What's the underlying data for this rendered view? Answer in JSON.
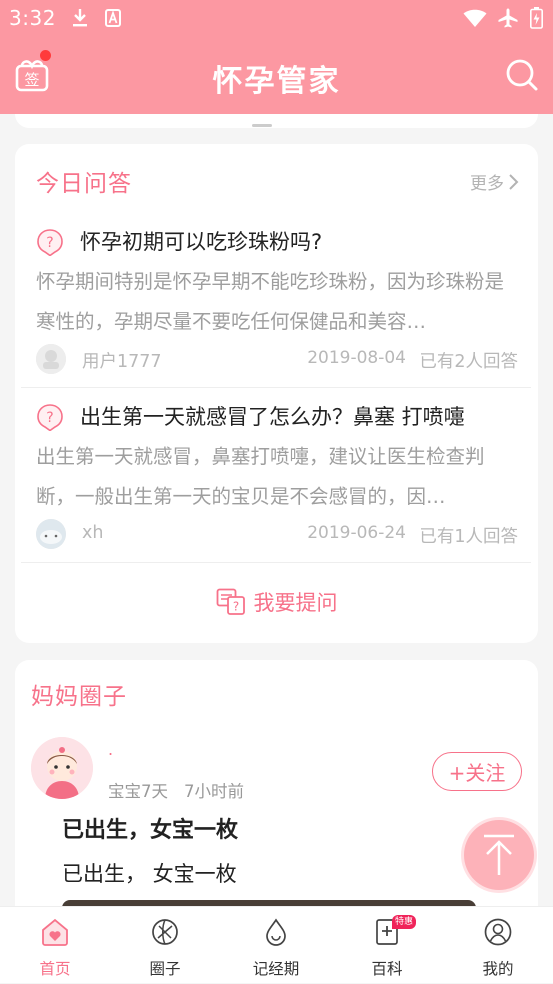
{
  "status_bar": {
    "time": "3:32",
    "icons": [
      "download-icon",
      "a-icon",
      "wifi-icon",
      "airplane-icon",
      "battery-icon"
    ]
  },
  "header": {
    "title": "怀孕管家",
    "checkin_label": "签",
    "left_icon": "checkin-gift-icon",
    "right_icon": "search-icon"
  },
  "qa": {
    "title": "今日问答",
    "more_label": "更多",
    "items": [
      {
        "question": "怀孕初期可以吃珍珠粉吗?",
        "answer_preview": "怀孕期间特别是怀孕早期不能吃珍珠粉，因为珍珠粉是寒性的，孕期尽量不要吃任何保健品和美容…",
        "user": "用户1777",
        "date": "2019-08-04",
        "answers": "已有2人回答"
      },
      {
        "question": "出生第一天就感冒了怎么办？鼻塞 打喷嚏",
        "answer_preview": "出生第一天就感冒，鼻塞打喷嚏，建议让医生检查判断，一般出生第一天的宝贝是不会感冒的，因…",
        "user": "xh",
        "date": "2019-06-24",
        "answers": "已有1人回答"
      }
    ],
    "ask_label": "我要提问"
  },
  "circle": {
    "title": "妈妈圈子",
    "post": {
      "author": ".",
      "baby_age": "宝宝7天",
      "time_ago": "7小时前",
      "follow_label": "+关注",
      "title": "已出生，女宝一枚",
      "body": "已出生， 女宝一枚"
    }
  },
  "tabbar": {
    "tabs": [
      {
        "label": "首页",
        "icon": "home-heart-icon",
        "active": true
      },
      {
        "label": "圈子",
        "icon": "circle-icon",
        "active": false
      },
      {
        "label": "记经期",
        "icon": "period-drop-icon",
        "active": false
      },
      {
        "label": "百科",
        "icon": "encyclopedia-icon",
        "active": false,
        "badge": "特惠"
      },
      {
        "label": "我的",
        "icon": "profile-icon",
        "active": false
      }
    ]
  },
  "colors": {
    "primary": "#fc98a2",
    "accent": "#f7728a",
    "muted": "#b8b8b8"
  }
}
